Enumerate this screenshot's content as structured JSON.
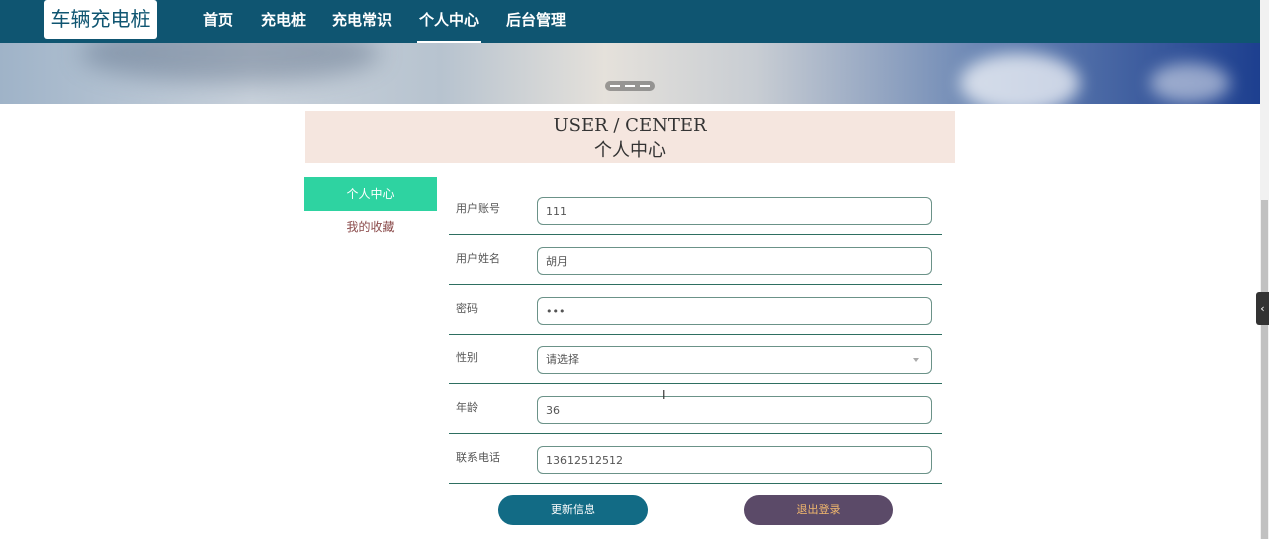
{
  "header": {
    "logo": "车辆充电桩",
    "nav": [
      {
        "label": "首页"
      },
      {
        "label": "充电桩"
      },
      {
        "label": "充电常识"
      },
      {
        "label": "个人中心",
        "active": true
      },
      {
        "label": "后台管理"
      }
    ]
  },
  "section_title": {
    "en": "USER / CENTER",
    "cn": "个人中心"
  },
  "sidebar": {
    "items": [
      {
        "label": "个人中心",
        "active": true
      },
      {
        "label": "我的收藏"
      }
    ]
  },
  "form": {
    "fields": [
      {
        "label": "用户账号",
        "value": "111"
      },
      {
        "label": "用户姓名",
        "value": "胡月"
      },
      {
        "label": "密码",
        "value": "•••"
      },
      {
        "label": "性别",
        "value": "请选择",
        "type": "select"
      },
      {
        "label": "年龄",
        "value": "36"
      },
      {
        "label": "联系电话",
        "value": "13612512512"
      }
    ],
    "update_label": "更新信息",
    "logout_label": "退出登录"
  },
  "colors": {
    "nav_bg": "#0f5571",
    "sidebar_active": "#2ed3a1",
    "update_button": "#126b85",
    "logout_button": "#5b4a68",
    "title_bg": "#f5e6df"
  },
  "icons": {
    "side_toggle": "chevron-left-icon",
    "select_arrow": "caret-down-icon"
  }
}
